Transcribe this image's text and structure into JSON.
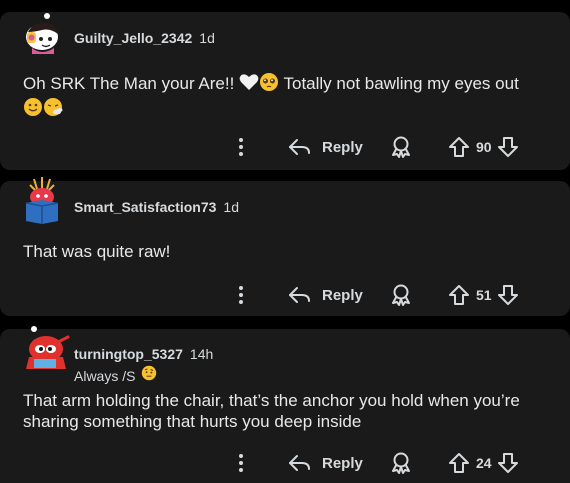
{
  "comments": [
    {
      "author": "Guilty_Jello_2342",
      "time": "1d",
      "text_before": "Oh SRK The Man your Are!!",
      "text_after": "Totally not bawling my eyes out",
      "emojis": [
        "white-heart",
        "pleading-face",
        "slightly-smiling-face",
        "face-with-steam"
      ],
      "reply_label": "Reply",
      "score": "90"
    },
    {
      "author": "Smart_Satisfaction73",
      "time": "1d",
      "text": "That was quite raw!",
      "reply_label": "Reply",
      "score": "51"
    },
    {
      "author": "turningtop_5327",
      "time": "14h",
      "flair": "Always /S",
      "flair_emoji": "face-with-raised-eyebrow",
      "text": "That arm holding the chair, that’s the anchor you hold when you’re sharing something that hurts you deep inside",
      "reply_label": "Reply",
      "score": "24"
    }
  ],
  "colors": {
    "background": "#000000",
    "card": "#1a1a1b",
    "text": "#d7dadc"
  }
}
